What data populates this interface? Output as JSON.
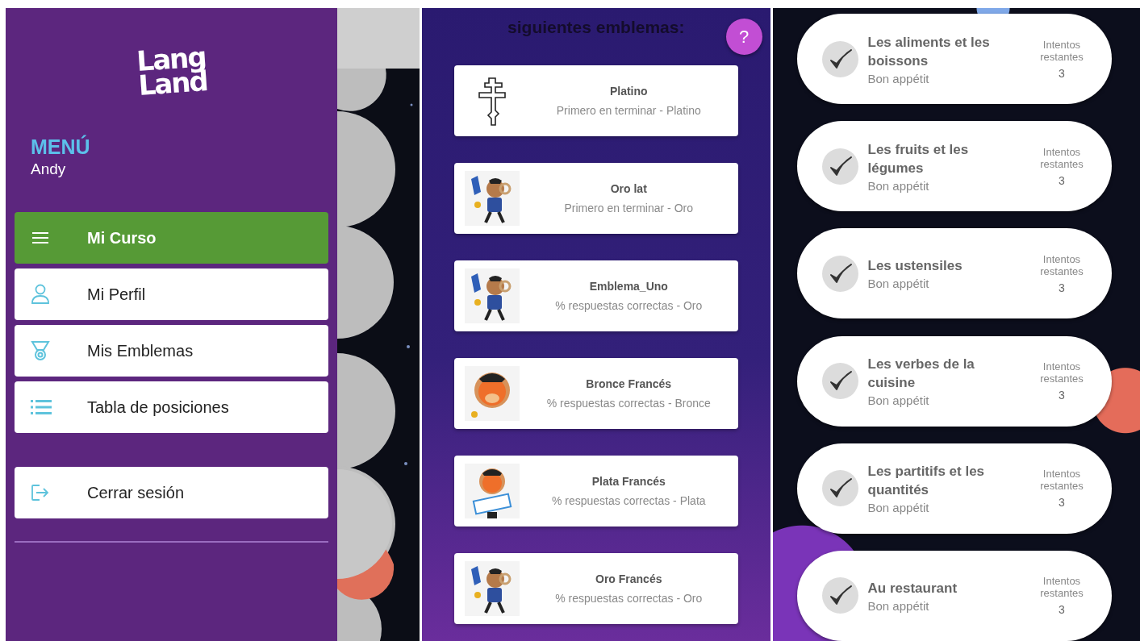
{
  "drawer": {
    "logo": "Lang Land",
    "heading": "MENÚ",
    "user": "Andy",
    "items": [
      {
        "kind": "menu",
        "label": "Mi Curso",
        "selected": true
      },
      {
        "kind": "person",
        "label": "Mi Perfil",
        "selected": false
      },
      {
        "kind": "medal",
        "label": "Mis Emblemas",
        "selected": false
      },
      {
        "kind": "list",
        "label": "Tabla de posiciones",
        "selected": false
      }
    ],
    "footer_items": [
      {
        "kind": "logout",
        "label": "Cerrar sesión",
        "selected": false
      }
    ]
  },
  "emblems": {
    "title": "siguientes emblemas:",
    "help_button": "?",
    "items": [
      {
        "kind": "cross",
        "name": "Platino",
        "description": "Primero en terminar - Platino"
      },
      {
        "kind": "ram",
        "name": "Oro lat",
        "description": "Primero en terminar - Oro"
      },
      {
        "kind": "ram",
        "name": "Emblema_Uno",
        "description": "% respuestas correctas - Oro"
      },
      {
        "kind": "lion",
        "name": "Bronce Francés",
        "description": "% respuestas correctas - Bronce"
      },
      {
        "kind": "sign",
        "name": "Plata Francés",
        "description": "% respuestas correctas - Plata"
      },
      {
        "kind": "ram",
        "name": "Oro Francés",
        "description": "% respuestas correctas - Oro"
      }
    ]
  },
  "lessons": {
    "items": [
      {
        "completed": true,
        "title": "Les aliments et les boissons",
        "unit": "Bon appétit",
        "attempts_label": "Intentos restantes",
        "attempts": "3"
      },
      {
        "completed": true,
        "title": "Les fruits et les légumes",
        "unit": "Bon appétit",
        "attempts_label": "Intentos restantes",
        "attempts": "3"
      },
      {
        "completed": true,
        "title": "Les ustensiles",
        "unit": "Bon appétit",
        "attempts_label": "Intentos restantes",
        "attempts": "3"
      },
      {
        "completed": true,
        "title": "Les verbes de la cuisine",
        "unit": "Bon appétit",
        "attempts_label": "Intentos restantes",
        "attempts": "3"
      },
      {
        "completed": true,
        "title": "Les partitifs et les quantités",
        "unit": "Bon appétit",
        "attempts_label": "Intentos restantes",
        "attempts": "3"
      },
      {
        "completed": true,
        "title": "Au restaurant",
        "unit": "Bon appétit",
        "attempts_label": "Intentos restantes",
        "attempts": "3"
      }
    ]
  }
}
